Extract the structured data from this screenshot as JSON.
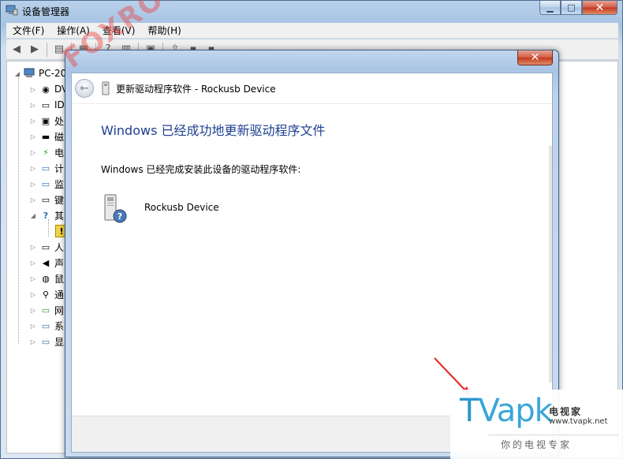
{
  "main_window": {
    "title": "设备管理器",
    "controls": {
      "minimize": "▁",
      "maximize": "□",
      "close": "✕"
    }
  },
  "menubar": {
    "items": [
      "文件(F)",
      "操作(A)",
      "查看(V)",
      "帮助(H)"
    ]
  },
  "toolbar": {
    "back_icon": "◀",
    "forward_icon": "▶",
    "tools": [
      "▤",
      "▦",
      "?",
      "▥",
      "▣",
      "⇧",
      "▪",
      "▪"
    ]
  },
  "tree": {
    "root": "PC-20",
    "items": [
      {
        "label": "DV",
        "icon": "optical-drive-icon",
        "glyph": "◉"
      },
      {
        "label": "ID",
        "icon": "ide-controller-icon",
        "glyph": "▭"
      },
      {
        "label": "处",
        "icon": "processor-icon",
        "glyph": "▣"
      },
      {
        "label": "磁",
        "icon": "disk-drive-icon",
        "glyph": "▬"
      },
      {
        "label": "电",
        "icon": "battery-icon",
        "glyph": "⚡"
      },
      {
        "label": "计",
        "icon": "computer-icon",
        "glyph": "▭"
      },
      {
        "label": "监",
        "icon": "monitor-icon",
        "glyph": "▭"
      },
      {
        "label": "键",
        "icon": "keyboard-icon",
        "glyph": "▭"
      },
      {
        "label": "其",
        "icon": "other-devices-icon",
        "glyph": "?"
      },
      {
        "label": "",
        "icon": "unknown-device-warning-icon",
        "glyph": "!"
      },
      {
        "label": "人",
        "icon": "hid-icon",
        "glyph": "▭"
      },
      {
        "label": "声",
        "icon": "sound-icon",
        "glyph": "◀"
      },
      {
        "label": "鼠",
        "icon": "mouse-icon",
        "glyph": "◍"
      },
      {
        "label": "通",
        "icon": "usb-controller-icon",
        "glyph": "⚲"
      },
      {
        "label": "网",
        "icon": "network-adapter-icon",
        "glyph": "▭"
      },
      {
        "label": "系",
        "icon": "system-devices-icon",
        "glyph": "▭"
      },
      {
        "label": "显",
        "icon": "display-adapter-icon",
        "glyph": "▭"
      }
    ]
  },
  "dialog": {
    "close": "✕",
    "back_glyph": "←",
    "header_title": "更新驱动程序软件 - Rockusb Device",
    "main_instruction": "Windows 已经成功地更新驱动程序文件",
    "sub_text": "Windows 已经完成安装此设备的驱动程序软件:",
    "device_name": "Rockusb Device"
  },
  "overlay": {
    "watermark": "FOXROM",
    "arrow_color": "#e8262a",
    "logo_main_t": "T",
    "logo_main_rest": "Vapk",
    "logo_cn": "电视家",
    "logo_url": "www.tvapk.net",
    "logo_slogan": "你的电视专家"
  }
}
